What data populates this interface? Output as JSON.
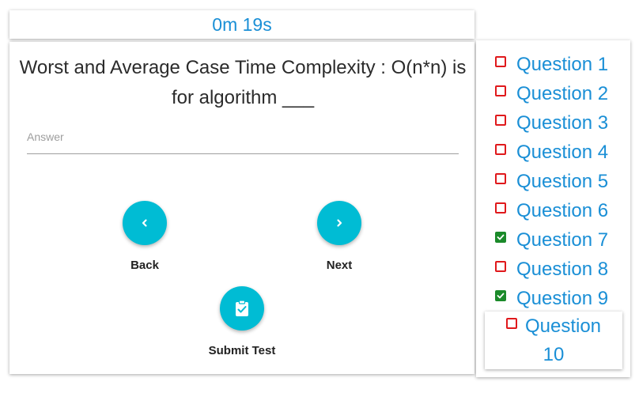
{
  "timer": {
    "text": "0m 19s"
  },
  "question": {
    "text": "Worst and Average Case Time Complexity : O(n*n) is for algorithm ___"
  },
  "answer": {
    "placeholder": "Answer",
    "value": ""
  },
  "buttons": {
    "back": "Back",
    "next": "Next",
    "submit": "Submit Test"
  },
  "icons": {
    "back": "chevron-left-icon",
    "next": "chevron-right-icon",
    "submit": "clipboard-check-icon"
  },
  "colors": {
    "accent": "#00bcd4",
    "link": "#1a8fd6",
    "unchecked": "#e0191c",
    "checked": "#1b8a2a"
  },
  "sidebar": {
    "items": [
      {
        "label": "Question 1",
        "checked": false
      },
      {
        "label": "Question 2",
        "checked": false
      },
      {
        "label": "Question 3",
        "checked": false
      },
      {
        "label": "Question 4",
        "checked": false
      },
      {
        "label": "Question 5",
        "checked": false
      },
      {
        "label": "Question 6",
        "checked": false
      },
      {
        "label": "Question 7",
        "checked": true
      },
      {
        "label": "Question 8",
        "checked": false
      },
      {
        "label": "Question 9",
        "checked": true
      },
      {
        "label": "Question",
        "label2": "10",
        "checked": false
      }
    ]
  }
}
